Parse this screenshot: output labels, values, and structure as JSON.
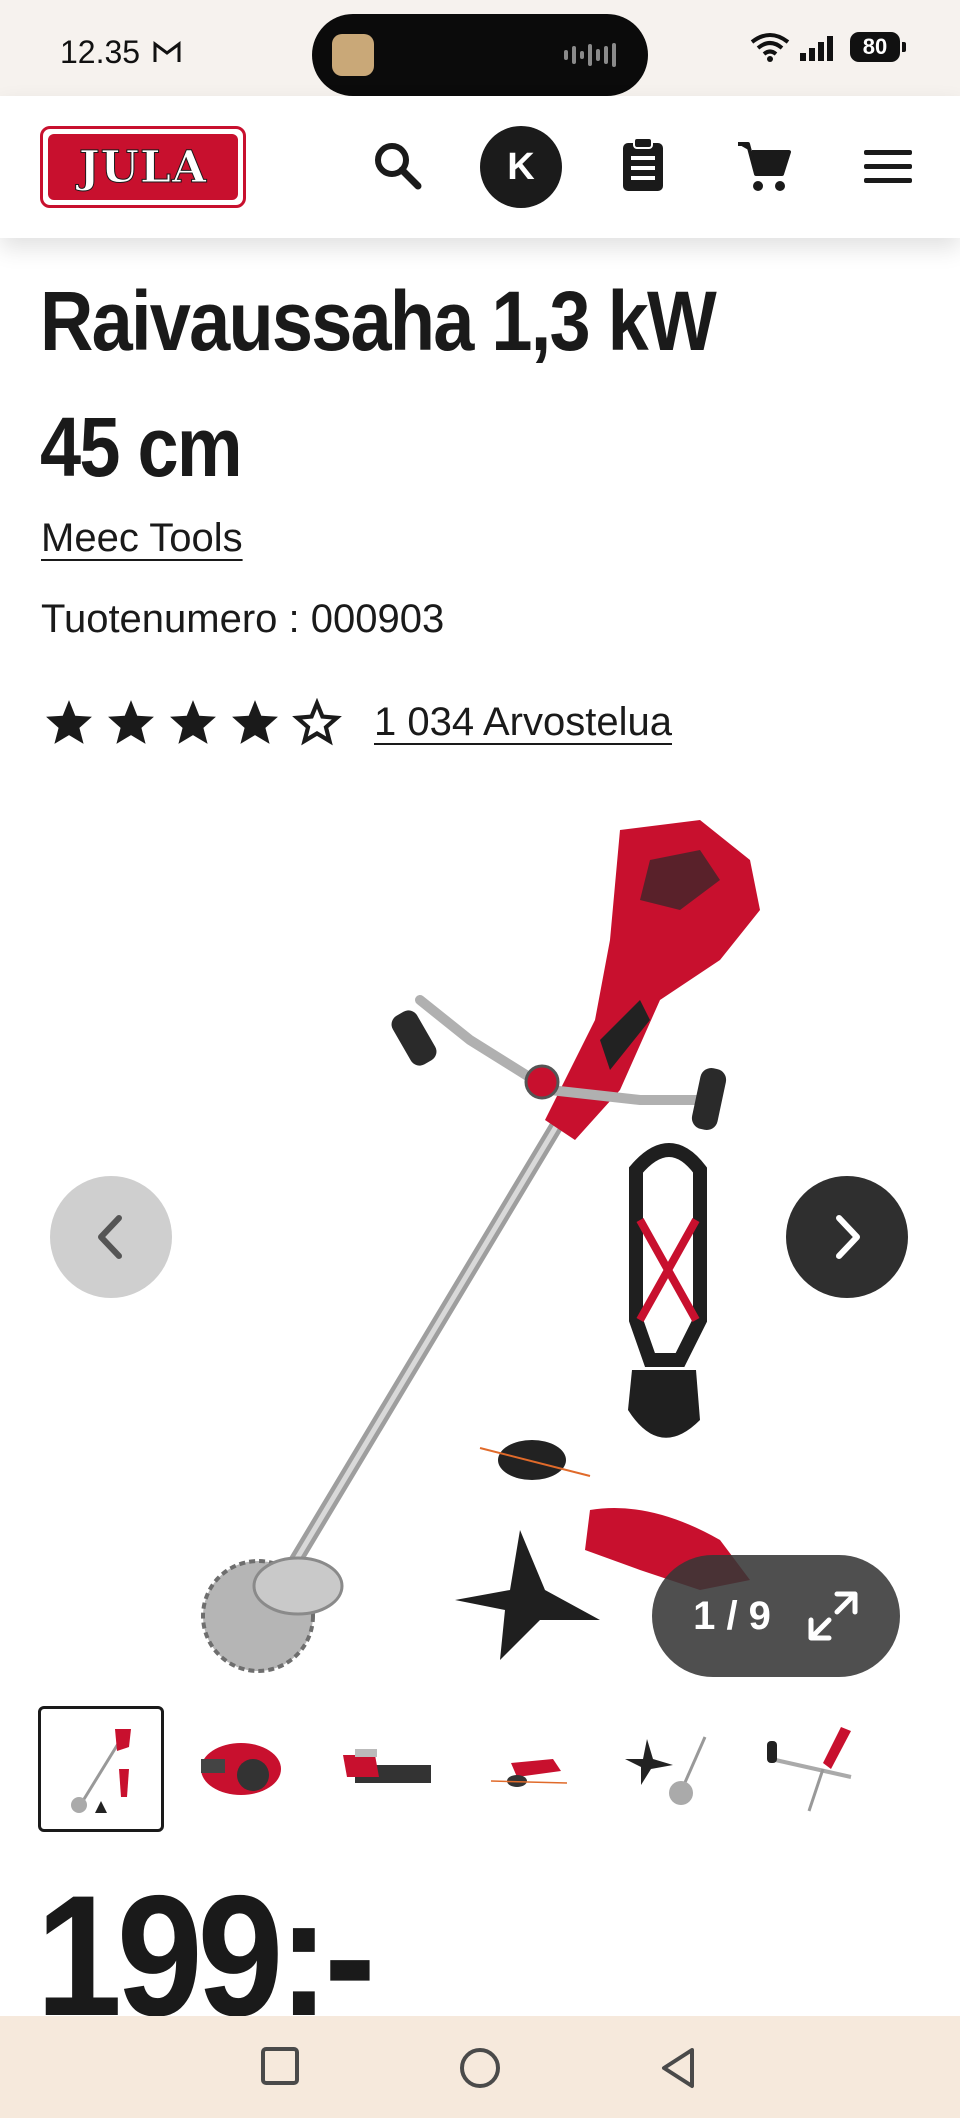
{
  "status_bar": {
    "time": "12.35",
    "battery": "80"
  },
  "header": {
    "logo_text": "JULA",
    "avatar_initial": "K"
  },
  "product": {
    "title": "Raivaussaha 1,3 kW 45 cm",
    "brand": "Meec Tools",
    "sku_label": "Tuotenumero : 000903",
    "rating": 4.5,
    "reviews_label": "1 034 Arvostelua",
    "price": "199:-"
  },
  "gallery": {
    "counter": "1 / 9",
    "current_index": 1,
    "total": 9,
    "thumbnails": [
      "thumb-trimmer-kit",
      "thumb-engine",
      "thumb-shaft",
      "thumb-trimmer-head",
      "thumb-blade",
      "thumb-handle"
    ]
  },
  "colors": {
    "brand_red": "#c8102e",
    "text_dark": "#1a1a1a",
    "status_bg": "#f6f2ee",
    "navbar_bg": "#f6e9dc"
  }
}
